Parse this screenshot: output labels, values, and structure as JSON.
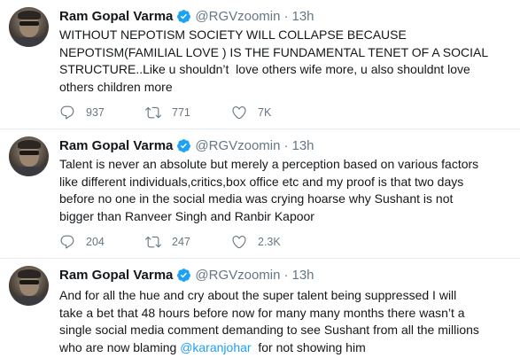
{
  "tweets": [
    {
      "name": "Ram Gopal Varma",
      "handle": "@RGVzoomin",
      "separator": "·",
      "time": "13h",
      "text": "WITHOUT NEPOTISM SOCIETY WILL COLLAPSE BECAUSE\nNEPOTISM(FAMILIAL LOVE ) IS THE FUNDAMENTAL TENET OF A SOCIAL\nSTRUCTURE..Like u shouldn’t  love others wife more, u also shouldnt love\nothers children more",
      "replies": "937",
      "retweets": "771",
      "likes": "7K"
    },
    {
      "name": "Ram Gopal Varma",
      "handle": "@RGVzoomin",
      "separator": "·",
      "time": "13h",
      "text": "Talent is never an absolute but merely a perception based on various factors\nlike different individuals,critics,box office etc and my proof is that two days\nbefore no one in the social media was crying hoarse why Sushant is not\nbigger than Ranveer Singh and Ranbir Kapoor",
      "replies": "204",
      "retweets": "247",
      "likes": "2.3K"
    },
    {
      "name": "Ram Gopal Varma",
      "handle": "@RGVzoomin",
      "separator": "·",
      "time": "13h",
      "text_before_mention": "And for all the hue and cry about the super talent being suppressed I will\ntake a bet that 48 hours before now for many many months there wasn’t a\nsingle social media comment demanding to see Sushant from all the millions\nwho are now blaming ",
      "mention": "@karanjohar",
      "text_after_mention": "  for not showing him"
    }
  ],
  "colors": {
    "accent": "#1da1f2",
    "secondary_text": "#657786",
    "divider": "#e6ecf0"
  },
  "icons": [
    "reply-icon",
    "retweet-icon",
    "like-icon",
    "verified-icon"
  ]
}
